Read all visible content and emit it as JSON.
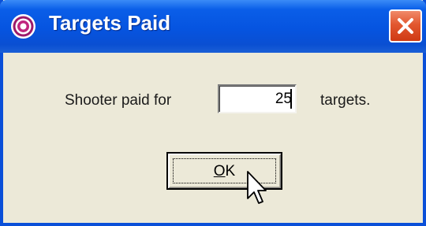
{
  "window": {
    "title": "Targets Paid",
    "colors": {
      "titlebar": "#0654e0",
      "close": "#e2572f",
      "face": "#ece9d8"
    }
  },
  "icons": {
    "app": "target-icon",
    "close": "close-icon",
    "pointer": "mouse-pointer-icon"
  },
  "dialog": {
    "prefix_label": "Shooter paid for",
    "quantity_value": "25",
    "suffix_label": "targets.",
    "ok_button": {
      "mnemonic": "O",
      "rest": "K"
    }
  }
}
